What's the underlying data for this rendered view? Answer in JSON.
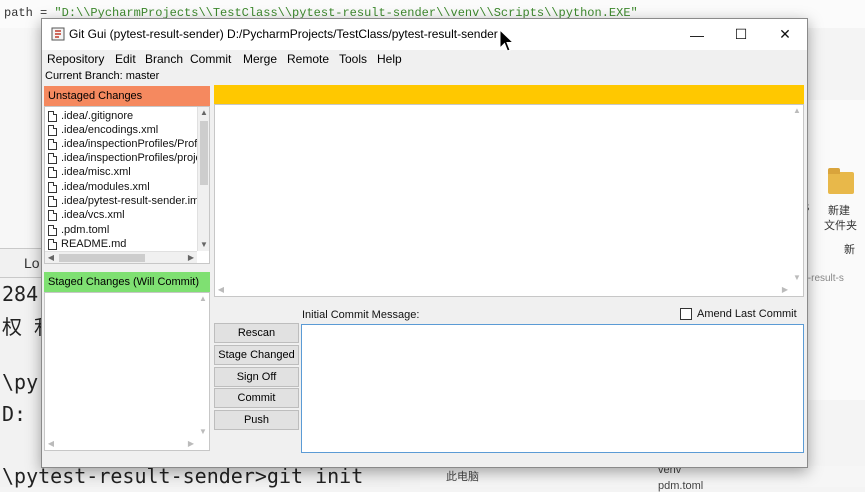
{
  "background": {
    "editor_line_prefix": "path = ",
    "editor_line_string": "\"D:\\\\PycharmProjects\\\\TestClass\\\\pytest-result-sender\\\\venv\\\\Scripts\\\\python.EXE\"",
    "side_tab_label": "Lo",
    "terminal_lines": [
      "284",
      "权 利",
      "\\py",
      "D:",
      "\\pytest-result-sender>git init"
    ],
    "explorer_new_folder": "新建",
    "explorer_new_folder_2": "文件夹",
    "explorer_partial_1": "S",
    "explorer_partial_2": "新",
    "explorer_path_fragment": "st-result-s",
    "taskbar_this_pc": "此电脑",
    "taskbar_venv": "venv",
    "taskbar_pdm": "pdm.toml"
  },
  "window": {
    "title": "Git Gui (pytest-result-sender) D:/PycharmProjects/TestClass/pytest-result-sender",
    "controls": {
      "minimize": "—",
      "maximize": "☐",
      "close": "✕"
    }
  },
  "menu": [
    "Repository",
    "Edit",
    "Branch",
    "Commit",
    "Merge",
    "Remote",
    "Tools",
    "Help"
  ],
  "current_branch": "Current Branch: master",
  "unstaged": {
    "header": "Unstaged Changes",
    "files": [
      ".idea/.gitignore",
      ".idea/encodings.xml",
      ".idea/inspectionProfiles/Profiles_settings.xml",
      ".idea/inspectionProfiles/project_default.xml",
      ".idea/misc.xml",
      ".idea/modules.xml",
      ".idea/pytest-result-sender.iml",
      ".idea/vcs.xml",
      ".pdm.toml",
      "README.md"
    ]
  },
  "staged": {
    "header": "Staged Changes (Will Commit)"
  },
  "buttons": {
    "rescan": "Rescan",
    "stage_changed": "Stage Changed",
    "sign_off": "Sign Off",
    "commit": "Commit",
    "push": "Push"
  },
  "commit_message": {
    "label": "Initial Commit Message:",
    "value": "",
    "amend_label": "Amend Last Commit",
    "amend_checked": false
  },
  "colors": {
    "unstaged_header": "#f5895f",
    "staged_header": "#7fe072",
    "diff_header": "#ffc800",
    "commit_focus_border": "#5b9bd5"
  },
  "icons": {
    "app": "git-gui-icon",
    "file": "file-icon",
    "cursor": "mouse-cursor-icon"
  }
}
